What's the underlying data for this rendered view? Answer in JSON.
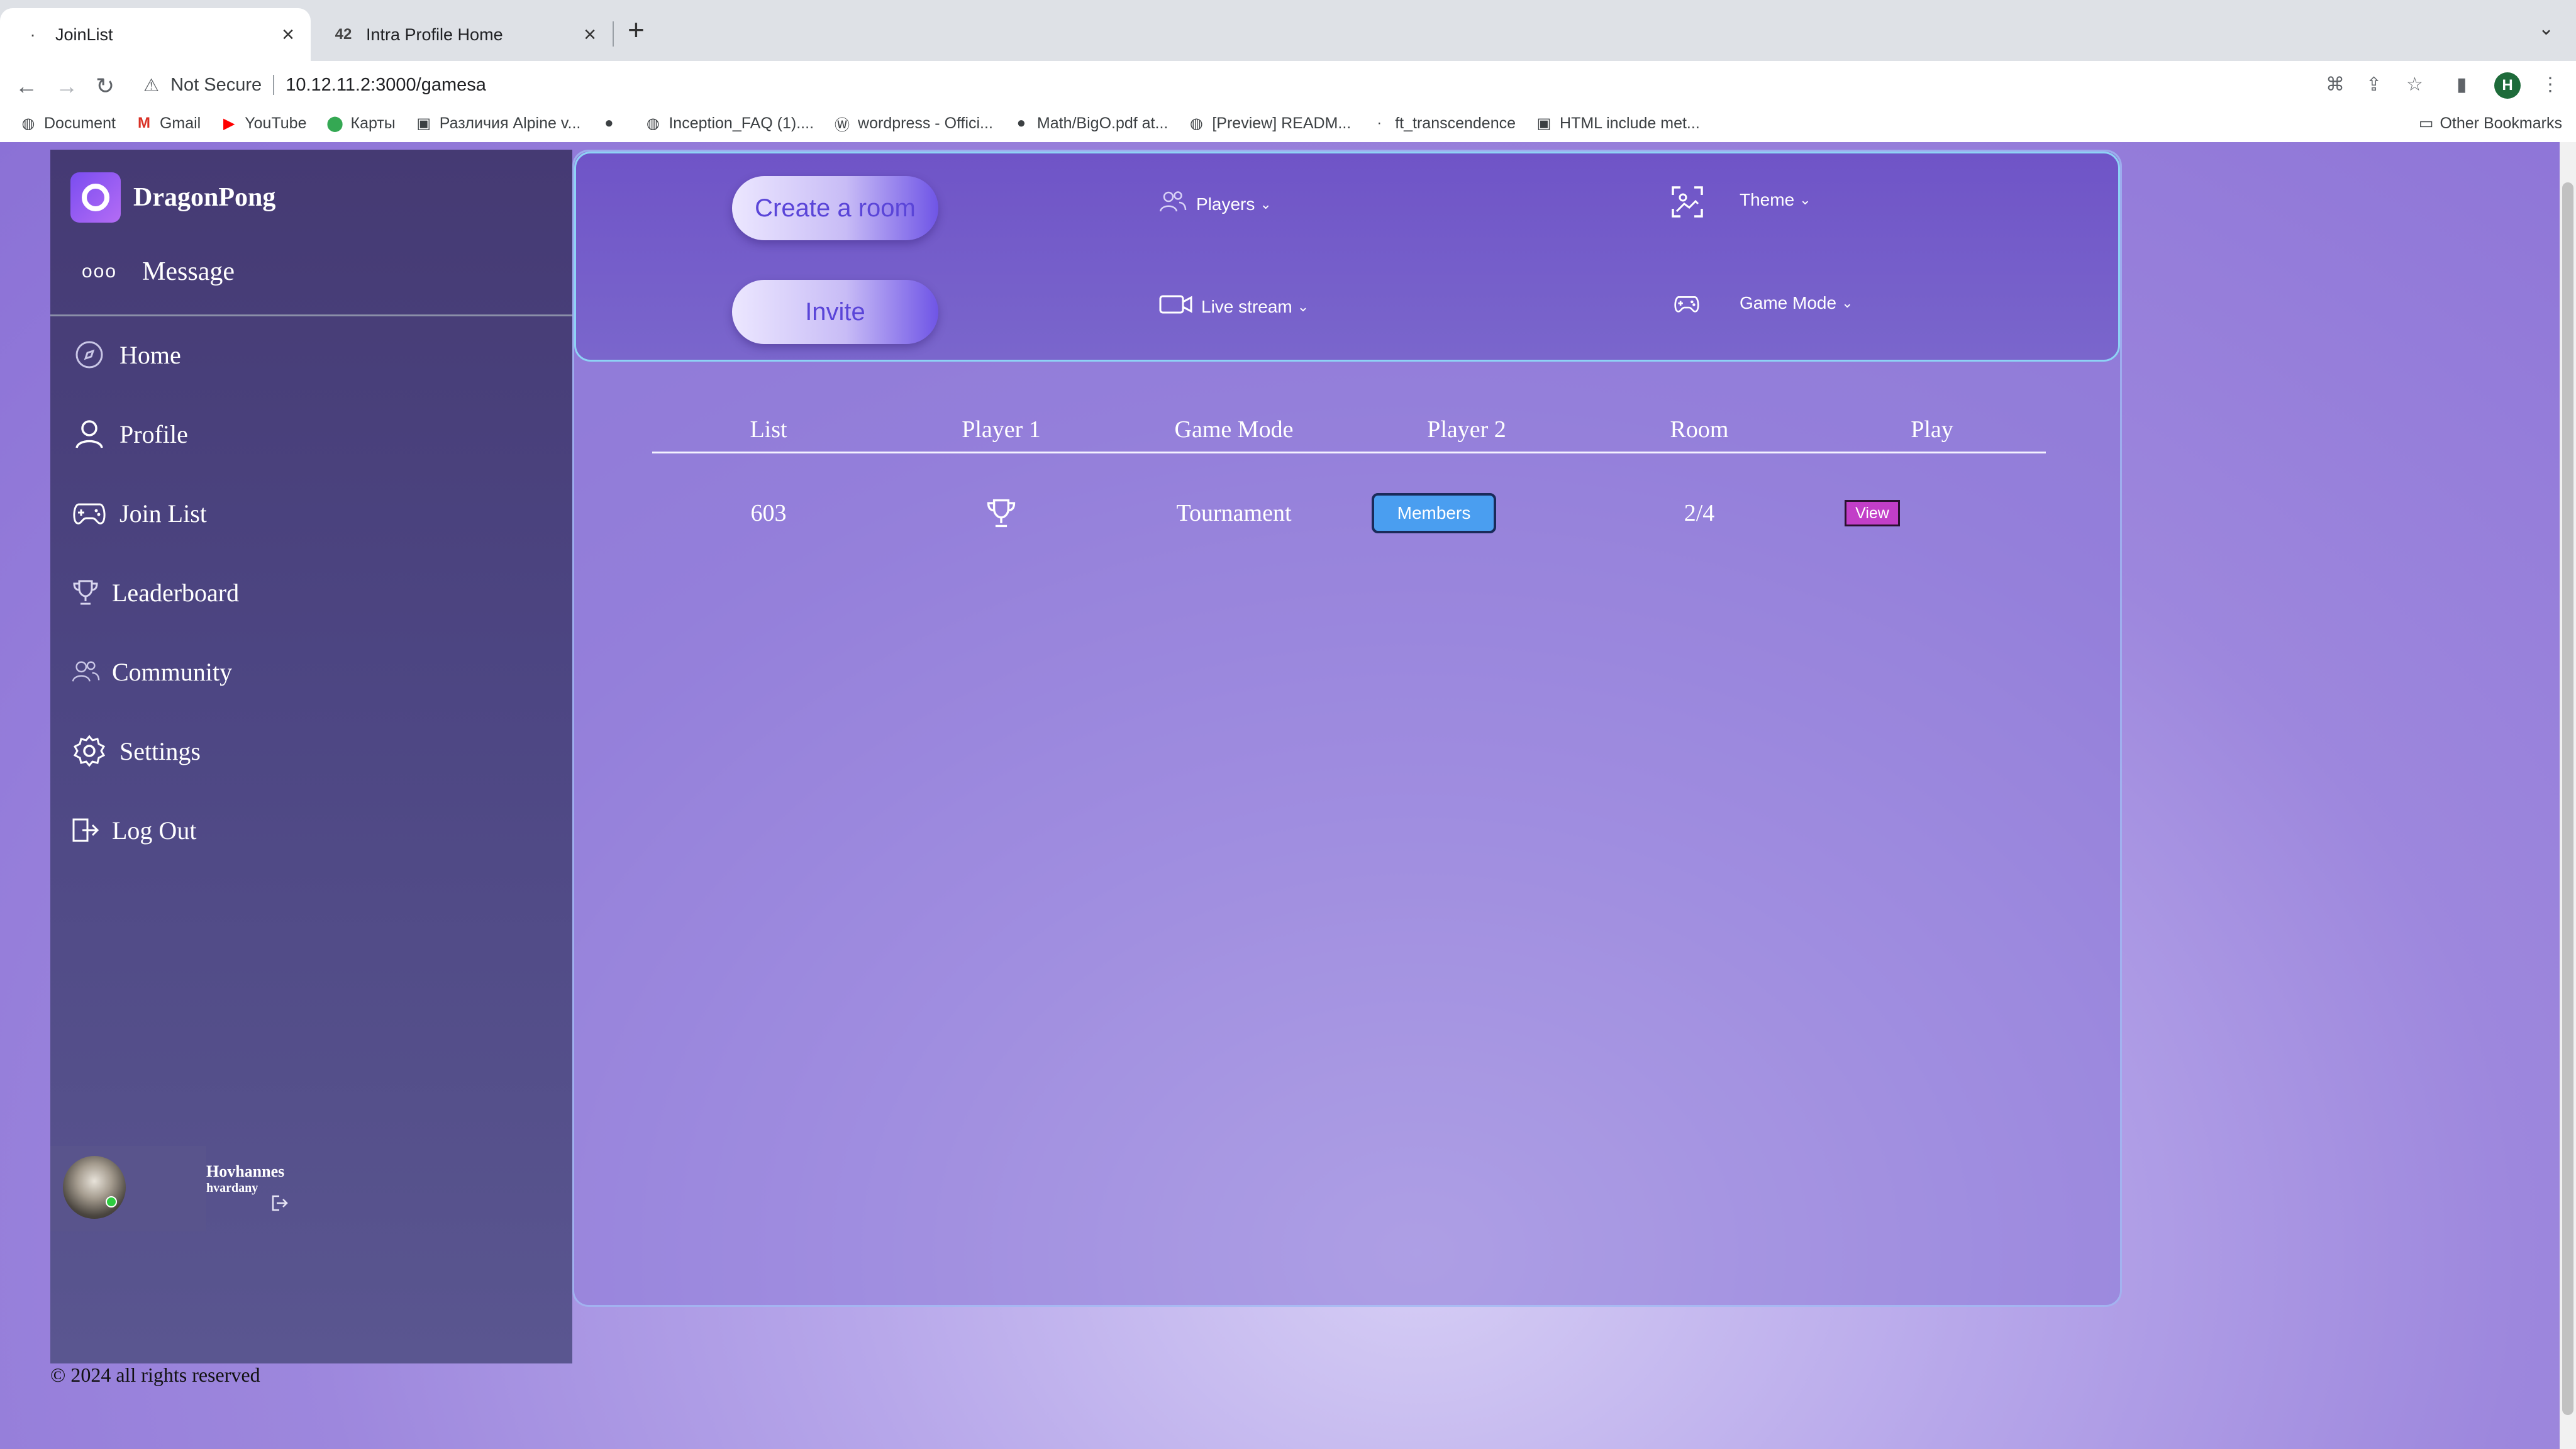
{
  "browser": {
    "tabs": [
      {
        "title": "JoinList",
        "active": true
      },
      {
        "title": "Intra Profile Home",
        "active": false
      }
    ],
    "security_label": "Not Secure",
    "url": "10.12.11.2:3000/gamesa",
    "profile_initial": "H",
    "bookmarks": [
      {
        "label": "Document",
        "icon": "globe-icon"
      },
      {
        "label": "Gmail",
        "icon": "gmail-icon"
      },
      {
        "label": "YouTube",
        "icon": "youtube-icon"
      },
      {
        "label": "Карты",
        "icon": "maps-pin-icon"
      },
      {
        "label": "Различия Alpine v...",
        "icon": "page-icon"
      },
      {
        "label": "",
        "icon": "github-icon"
      },
      {
        "label": "Inception_FAQ (1)....",
        "icon": "globe-icon"
      },
      {
        "label": "wordpress - Offici...",
        "icon": "wordpress-icon"
      },
      {
        "label": "Math/BigO.pdf at...",
        "icon": "github-icon"
      },
      {
        "label": "[Preview] READM...",
        "icon": "globe-icon"
      },
      {
        "label": "ft_transcendence",
        "icon": "dot-icon"
      },
      {
        "label": "HTML include met...",
        "icon": "page-icon"
      }
    ],
    "other_bookmarks": "Other Bookmarks"
  },
  "sidebar": {
    "brand": "DragonPong",
    "message_label": "Message",
    "items": [
      {
        "label": "Home",
        "icon": "compass-icon"
      },
      {
        "label": "Profile",
        "icon": "user-icon"
      },
      {
        "label": "Join List",
        "icon": "gamepad-icon"
      },
      {
        "label": "Leaderboard",
        "icon": "trophy-icon"
      },
      {
        "label": "Community",
        "icon": "users-icon"
      },
      {
        "label": "Settings",
        "icon": "gear-icon"
      },
      {
        "label": "Log Out",
        "icon": "logout-icon"
      }
    ],
    "user": {
      "name": "Hovhannes",
      "login": "hvardany",
      "status_color": "#2ecc40"
    }
  },
  "toolbar": {
    "create_room_label": "Create a room",
    "invite_label": "Invite",
    "players_label": "Players",
    "live_stream_label": "Live stream",
    "theme_label": "Theme",
    "game_mode_label": "Game Mode"
  },
  "table": {
    "headers": [
      "List",
      "Player 1",
      "Game Mode",
      "Player 2",
      "Room",
      "Play"
    ],
    "rows": [
      {
        "list": "603",
        "player1_icon": "trophy-icon",
        "game_mode": "Tournament",
        "player2_button": "Members",
        "room": "2/4",
        "play_button": "View"
      }
    ]
  },
  "footer": "© 2024 all rights reserved",
  "colors": {
    "sidebar_bg": "#4d4683",
    "topbar_border": "#8ed2f5",
    "members_button": "#4a9ef0",
    "view_button": "#c23ec8"
  }
}
